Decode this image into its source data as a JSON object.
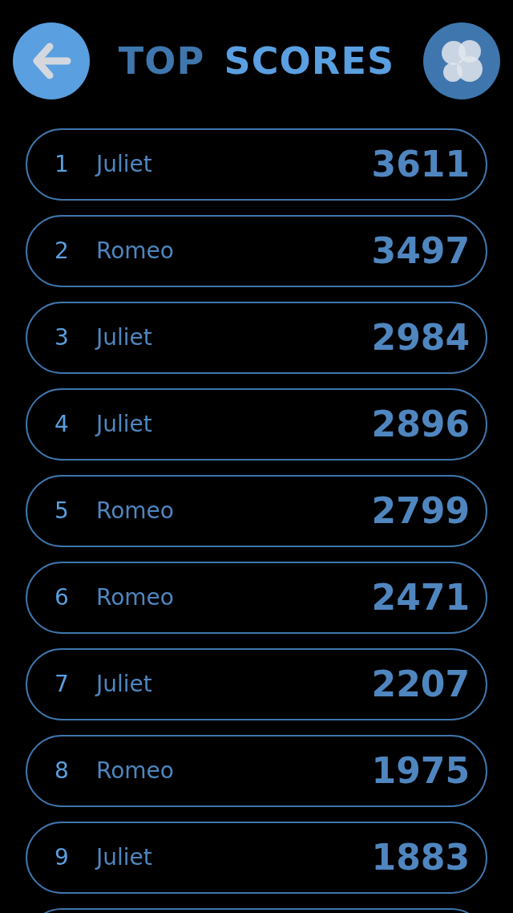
{
  "header": {
    "title_first": "TOP",
    "title_second": "SCORES"
  },
  "scores": [
    {
      "rank": "1",
      "name": "Juliet",
      "score": "3611"
    },
    {
      "rank": "2",
      "name": "Romeo",
      "score": "3497"
    },
    {
      "rank": "3",
      "name": "Juliet",
      "score": "2984"
    },
    {
      "rank": "4",
      "name": "Juliet",
      "score": "2896"
    },
    {
      "rank": "5",
      "name": "Romeo",
      "score": "2799"
    },
    {
      "rank": "6",
      "name": "Romeo",
      "score": "2471"
    },
    {
      "rank": "7",
      "name": "Juliet",
      "score": "2207"
    },
    {
      "rank": "8",
      "name": "Romeo",
      "score": "1975"
    },
    {
      "rank": "9",
      "name": "Juliet",
      "score": "1883"
    }
  ]
}
